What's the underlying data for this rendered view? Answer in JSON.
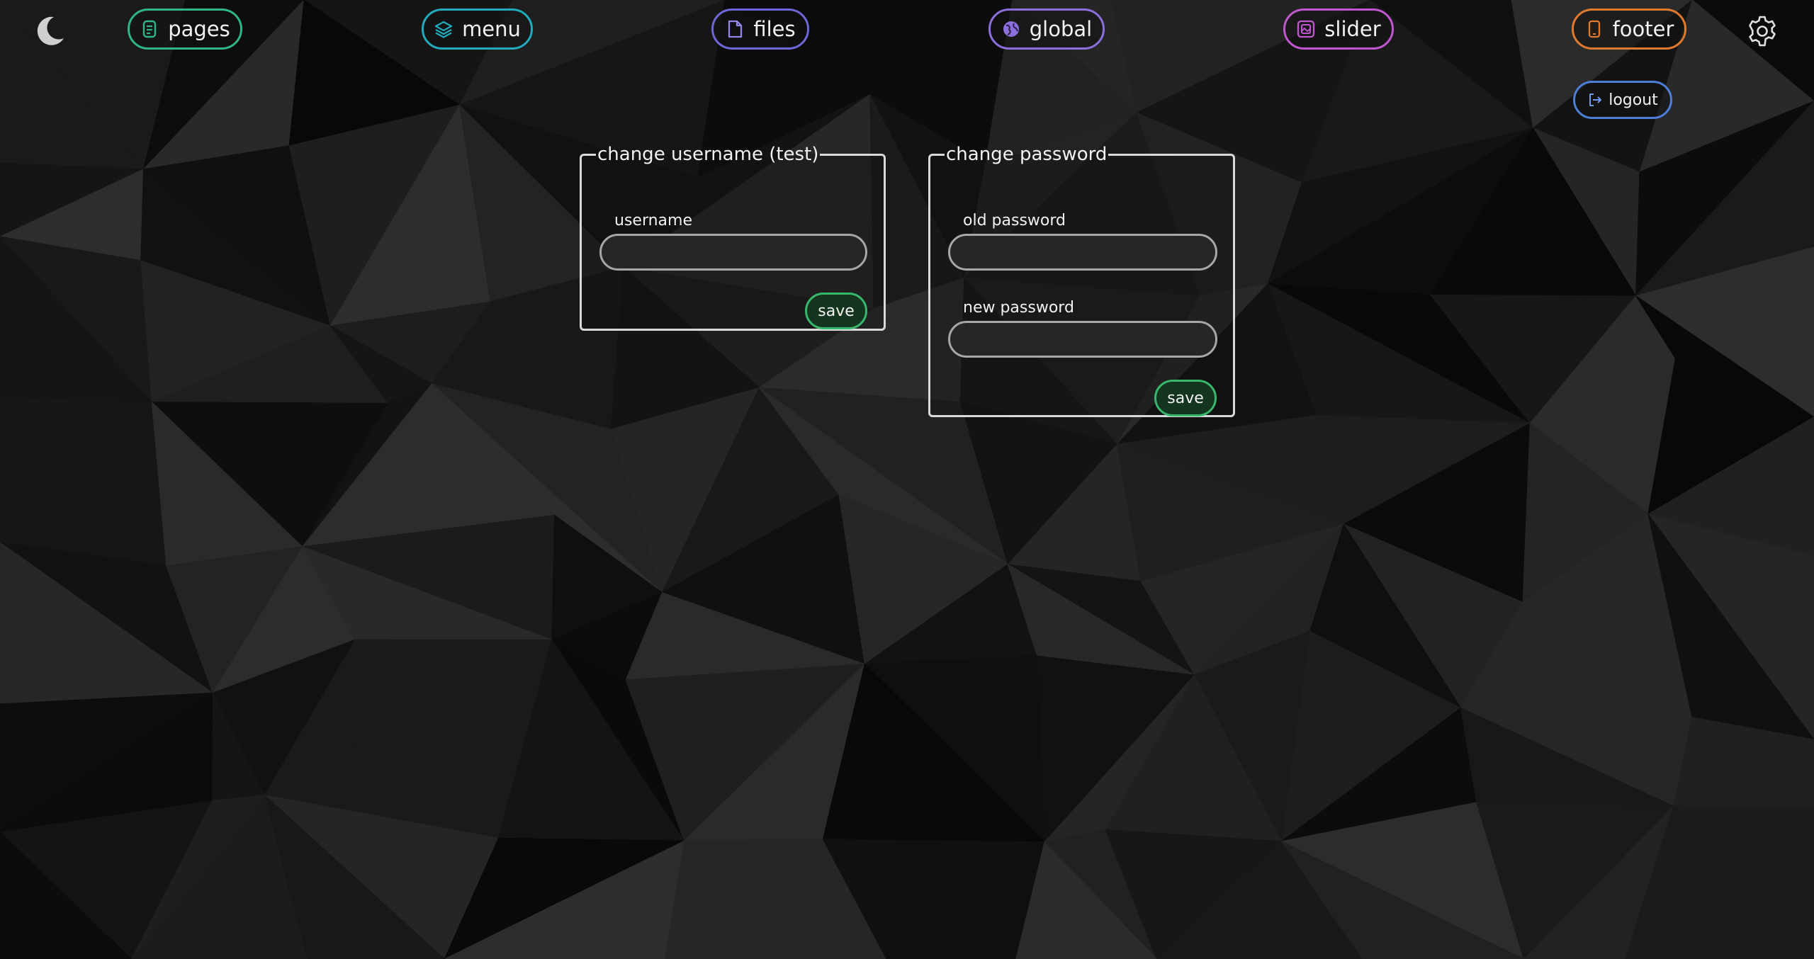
{
  "colors": {
    "pages": "#2fb783",
    "menu": "#22aabd",
    "files": "#6f66d8",
    "global": "#8c6fdc",
    "slider": "#c157cf",
    "footer": "#e07a2e",
    "logout": "#4d7fd8",
    "save": "#38b86c",
    "panel_border": "#d9d9d9",
    "input_border": "#a7a7a7"
  },
  "nav": {
    "items": [
      {
        "label": "pages",
        "icon": "document-icon"
      },
      {
        "label": "menu",
        "icon": "layers-icon"
      },
      {
        "label": "files",
        "icon": "file-icon"
      },
      {
        "label": "global",
        "icon": "globe-icon"
      },
      {
        "label": "slider",
        "icon": "image-frame-icon"
      },
      {
        "label": "footer",
        "icon": "mobile-device-icon"
      }
    ],
    "theme_icon": "moon-icon",
    "settings_icon": "gear-icon",
    "logout": {
      "label": "logout",
      "icon": "logout-icon"
    }
  },
  "username_form": {
    "legend": "change username (test)",
    "label": "username",
    "value": "",
    "save_label": "save"
  },
  "password_form": {
    "legend": "change password",
    "old_label": "old password",
    "old_value": "",
    "new_label": "new password",
    "new_value": "",
    "save_label": "save"
  }
}
